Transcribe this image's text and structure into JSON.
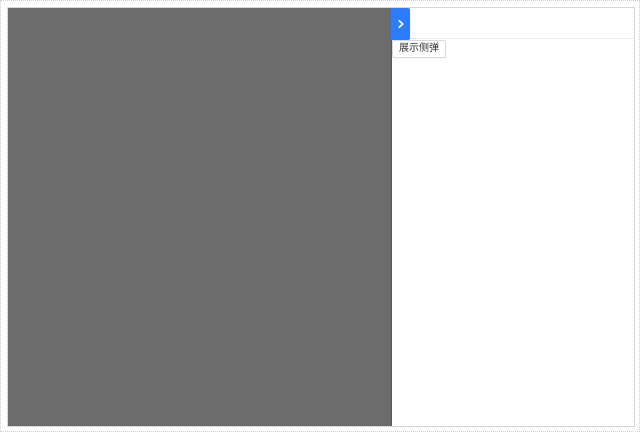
{
  "drawer": {
    "toggle_icon": "chevron-right-icon"
  },
  "actions": {
    "show_drawer_label": "展示侧弹"
  },
  "colors": {
    "accent": "#2b7cff",
    "panel_bg": "#6c6c6c",
    "page_bg": "#ffffff"
  }
}
